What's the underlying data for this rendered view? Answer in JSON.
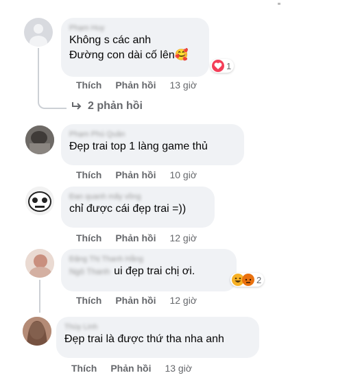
{
  "comments": [
    {
      "author": "Phạm Huy",
      "lines": [
        "Không s các anh",
        "Đường con dài cố lên🥰"
      ],
      "reaction_count": "1",
      "like": "Thích",
      "reply": "Phản hồi",
      "time": "13 giờ",
      "replies_label": "2 phản hồi"
    },
    {
      "author": "Phạm Phú Quân",
      "lines": [
        "Đẹp trai top 1 làng game thủ"
      ],
      "like": "Thích",
      "reply": "Phản hồi",
      "time": "10 giờ"
    },
    {
      "author": "Đan quanh mấy vồng",
      "lines": [
        "chỉ được cái đẹp trai =))"
      ],
      "like": "Thích",
      "reply": "Phản hồi",
      "time": "12 giờ"
    },
    {
      "author": "Đặng Thị Thanh Hằng",
      "author2": "Ngô Thanh",
      "lines": [
        "ui đẹp trai chị ơi."
      ],
      "reaction_count": "2",
      "like": "Thích",
      "reply": "Phản hồi",
      "time": "12 giờ"
    },
    {
      "author": "Thùy Linh",
      "lines": [
        "Đẹp trai là được thứ tha nha anh"
      ],
      "like": "Thích",
      "reply": "Phản hồi",
      "time": "13 giờ"
    }
  ],
  "colors": {
    "bubble": "#f0f2f5",
    "meta": "#65676b",
    "love": "#f33e58",
    "haha": "#f7b125",
    "angry": "#e9710f"
  }
}
